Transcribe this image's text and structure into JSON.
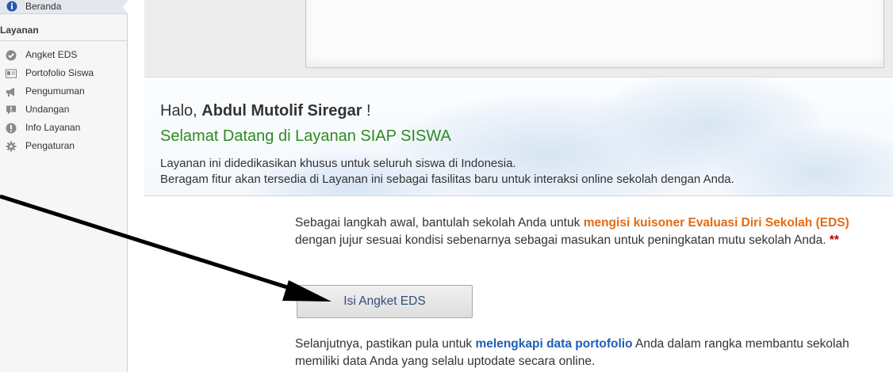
{
  "sidebar": {
    "active_item": "Beranda",
    "section_header": "Layanan",
    "items": [
      {
        "label": "Angket EDS",
        "icon": "check-circle-icon"
      },
      {
        "label": "Portofolio Siswa",
        "icon": "id-card-icon"
      },
      {
        "label": "Pengumuman",
        "icon": "megaphone-icon"
      },
      {
        "label": "Undangan",
        "icon": "speech-bubble-icon"
      },
      {
        "label": "Info Layanan",
        "icon": "exclamation-circle-icon"
      },
      {
        "label": "Pengaturan",
        "icon": "gear-icon"
      }
    ]
  },
  "welcome": {
    "greeting_prefix": "Halo,",
    "user_name": "Abdul Mutolif Siregar",
    "greeting_suffix": "!",
    "title": "Selamat Datang di Layanan SIAP SISWA",
    "desc_line1": "Layanan ini didedikasikan khusus untuk seluruh siswa di Indonesia.",
    "desc_line2": "Beragam fitur akan tersedia di Layanan ini sebagai fasilitas baru untuk interaksi online sekolah dengan Anda."
  },
  "eds": {
    "text_before": "Sebagai langkah awal, bantulah sekolah Anda untuk",
    "highlight": "mengisi kuisoner Evaluasi Diri Sekolah (EDS)",
    "text_after": "dengan jujur sesuai kondisi sebenarnya sebagai masukan untuk peningkatan mutu sekolah Anda.",
    "marker": "**",
    "button_label": "Isi Angket EDS"
  },
  "portfolio": {
    "text_before": "Selanjutnya, pastikan pula untuk",
    "highlight": "melengkapi data portofolio",
    "text_after": "Anda dalam rangka membantu sekolah memiliki data Anda yang selalu uptodate secara online."
  },
  "colors": {
    "accent_orange": "#e36b12",
    "accent_blue": "#1f5fb5",
    "welcome_green": "#2e8b1f",
    "marker_red": "#c00000"
  }
}
